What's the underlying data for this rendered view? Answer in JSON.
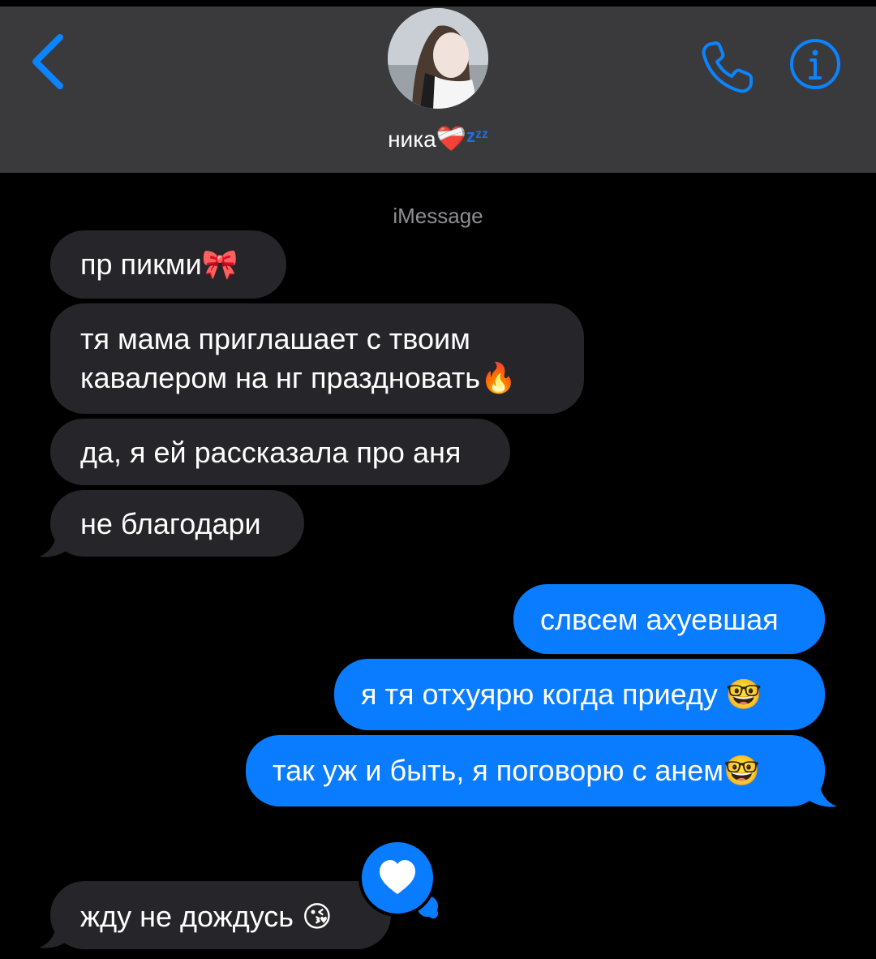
{
  "header": {
    "contact_name": "ника",
    "contact_heart": "❤️‍🩹",
    "contact_sleep": "zᶻᶻ",
    "back_icon": "chevron-left-icon",
    "phone_icon": "phone-icon",
    "info_icon": "info-icon",
    "accent_color": "#0a7cff"
  },
  "service_label": "iMessage",
  "messages": [
    {
      "direction": "incoming",
      "text": "пр пикми",
      "emoji": "🎀"
    },
    {
      "direction": "incoming",
      "line1": "тя мама приглашает с твоим",
      "line2": "кавалером на нг праздновать",
      "emoji": "🔥"
    },
    {
      "direction": "incoming",
      "text": "да, я ей рассказала про аня"
    },
    {
      "direction": "incoming",
      "text": "не благодари"
    },
    {
      "direction": "outgoing",
      "text": "слвсем ахуевшая"
    },
    {
      "direction": "outgoing",
      "text": "я тя отхуярю когда приеду ",
      "emoji": "🤓"
    },
    {
      "direction": "outgoing",
      "text": "так уж и быть, я поговорю с анем",
      "emoji": "🤓"
    },
    {
      "direction": "incoming",
      "text": "жду не дождусь ",
      "emoji": "😘",
      "reaction": "heart-icon"
    }
  ],
  "colors": {
    "incoming_bubble": "#26252a",
    "outgoing_bubble": "#0a7cff",
    "header_bg": "#3a3a3c"
  }
}
